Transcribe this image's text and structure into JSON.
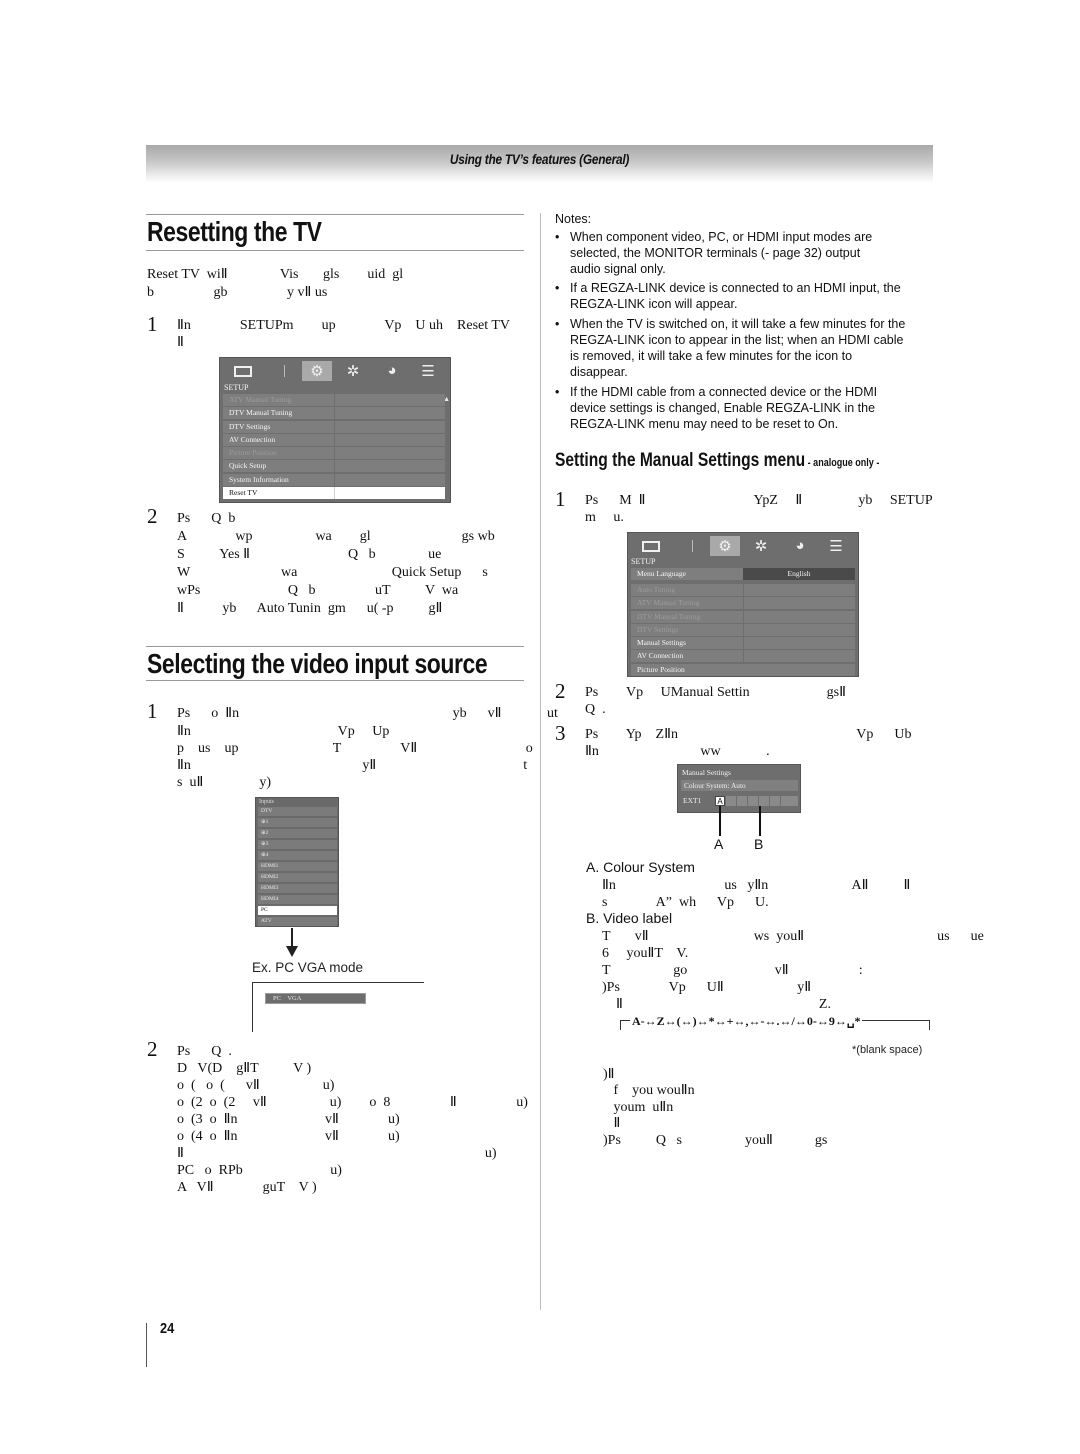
{
  "header": {
    "section_title": "Using the TV’s features (General)"
  },
  "resetting": {
    "title": "Resetting the TV",
    "intro_lines": [
      "Reset TV  wiⅡ               Vis       gls        uid  gl",
      "b                 gb                 y vⅡ us"
    ],
    "step1": {
      "num": "1",
      "lines": [
        "Ⅱn              SETUPm        up              Vp    U uh    Reset TV",
        "Ⅱ"
      ]
    },
    "menu": {
      "icons": [
        "picture-icon",
        "setup-icon",
        "preferences-icon",
        "timer-icon",
        "sound-icon"
      ],
      "title": "SETUP",
      "items": [
        {
          "label": "ATV Manual Tuning",
          "state": "dim"
        },
        {
          "label": "DTV Manual Tuning",
          "state": "normal"
        },
        {
          "label": "DTV Settings",
          "state": "normal"
        },
        {
          "label": "AV Connection",
          "state": "normal"
        },
        {
          "label": "Picture Position",
          "state": "dim"
        },
        {
          "label": "Quick Setup",
          "state": "normal"
        },
        {
          "label": "System Information",
          "state": "normal"
        },
        {
          "label": "Reset TV",
          "state": "selected"
        }
      ]
    },
    "step2": {
      "num": "2",
      "lines": [
        "Ps      Q  b",
        "A              wp                  wa        gl                          gs wb",
        "S          Yes Ⅱ                            Q   b               ue",
        "W                          wa                           Quick Setup      s",
        "wPs                         Q   b                 uT          V  wa",
        "Ⅱ           yb      Auto Tunin  gm      u( -p          gⅡ"
      ]
    }
  },
  "selecting": {
    "title": "Selecting the video input source",
    "step1": {
      "num": "1",
      "lines": [
        "Ps      o  Ⅱn                                                             yb      vⅡ             ut",
        "Ⅱn                                          Vp     Up",
        "p    us    up                           T                 VⅡ                               o",
        "Ⅱn                                                 yⅡ                                          t",
        "s  uⅡ                y)"
      ]
    },
    "inputs_menu": {
      "title": "Inputs",
      "items": [
        {
          "label": "DTV",
          "selected": false
        },
        {
          "label": "⊕1",
          "selected": false
        },
        {
          "label": "⊕2",
          "selected": false
        },
        {
          "label": "⊕3",
          "selected": false
        },
        {
          "label": "⊕4",
          "selected": false
        },
        {
          "label": "HDMI1",
          "selected": false
        },
        {
          "label": "HDMI2",
          "selected": false
        },
        {
          "label": "HDMI3",
          "selected": false
        },
        {
          "label": "HDMI4",
          "selected": false
        },
        {
          "label": "PC",
          "selected": true
        },
        {
          "label": "ATV",
          "selected": false
        }
      ]
    },
    "example_label": "Ex. PC VGA mode",
    "example_banner": "PC    VGA",
    "step2": {
      "num": "2",
      "lines": [
        "Ps      Q  .",
        "D   V(D    gⅡT          V )",
        "o  (   o  (      vⅡ                  u)",
        "o  (2  o  (2     vⅡ                  u)        o  8                 Ⅱ                 u)",
        "o  (3  o  Ⅱn                         vⅡ              u)",
        "o  (4  o  Ⅱn                         vⅡ              u)",
        "Ⅱ                                                                                      u)",
        "PC   o  RPb                         u)",
        "A   VⅡ              guT    V )"
      ]
    }
  },
  "notes": {
    "title": "Notes:",
    "items": [
      [
        "When component video, PC, or HDMI input modes are",
        "selected, the  MONITOR terminals (-     page 32) output",
        "audio signal only."
      ],
      [
        "If a REGZA-LINK device is connected to an HDMI input, the",
        "REGZA-LINK  icon will appear."
      ],
      [
        "When the TV is switched on, it will take a few minutes for the",
        "REGZA-LINK  icon to appear in the list; when an HDMI cable",
        "is removed, it will take a few minutes for the icon to",
        "disappear."
      ],
      [
        "If the HDMI cable from a connected device or the HDMI",
        "device settings is changed,  Enable REGZA-LINK  in the",
        "REGZA-LINK  menu may need to be reset to  On."
      ]
    ]
  },
  "manual_settings": {
    "title": "Setting the Manual Settings menu",
    "qualifier": " - analogue only -",
    "step1": {
      "num": "1",
      "lines": [
        "Ps      M  Ⅱ                               YpZ     Ⅱ                yb     SETUP",
        "m     u."
      ]
    },
    "menu": {
      "icons": [
        "picture-icon",
        "setup-icon",
        "preferences-icon",
        "timer-icon",
        "sound-icon"
      ],
      "title": "SETUP",
      "items": [
        {
          "label": "Menu Language",
          "value": "English",
          "state": "normal"
        },
        {
          "label": "Auto Tuning",
          "state": "dim"
        },
        {
          "label": "ATV Manual Tuning",
          "state": "dim"
        },
        {
          "label": "DTV Manual Tuning",
          "state": "dim"
        },
        {
          "label": "DTV Settings",
          "state": "dim"
        },
        {
          "label": "Manual Settings",
          "state": "normal"
        },
        {
          "label": "AV Connection",
          "state": "normal"
        },
        {
          "label": "Picture Position",
          "state": "normal"
        }
      ]
    },
    "step2": {
      "num": "2",
      "lines": [
        "Ps        Vp     UManual Settin                      gsⅡ",
        "Q  ."
      ]
    },
    "step3": {
      "num": "3",
      "lines": [
        "Ps        Yp    ZⅡn                                                   Vp      Ub",
        "Ⅱn                             ww             ."
      ]
    },
    "widget": {
      "title": "Manual Settings",
      "colour_row": "Colour System: Auto",
      "ext_label": "EXT1",
      "first_char": "A",
      "callout_a": "A",
      "callout_b": "B"
    },
    "a_heading": "A. Colour System",
    "a_lines": [
      "Ⅱn                               us   yⅡn                        AⅡ          Ⅱ",
      "s              A”  wh      Vp      U."
    ],
    "b_heading": "B. Video label",
    "b_lines": [
      "T       vⅡ                              ws  youⅡ                                      us      ue",
      "6     youⅡT    V.",
      "T                  go                         vⅡ                    :",
      ")Ps              Vp      UⅡ                     yⅡ",
      "    Ⅱ                                                        Z."
    ],
    "char_sequence": "A-↔Z↔(↔)↔*↔+↔,↔-↔.↔/↔0-↔9↔␣*",
    "blank_note": "*(blank space)",
    "c_lines": [
      ")Ⅱ",
      "   f    you wouⅡn",
      "   youm  uⅡn",
      "   Ⅱ",
      ")Ps          Q   s                  youⅡ            gs"
    ]
  },
  "page_number": "24"
}
